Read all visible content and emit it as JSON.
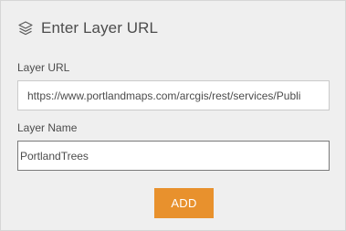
{
  "header": {
    "title": "Enter Layer URL",
    "icon": "layers-icon"
  },
  "form": {
    "url_label": "Layer URL",
    "url_value": "https://www.portlandmaps.com/arcgis/rest/services/Publi",
    "name_label": "Layer Name",
    "name_value": "PortlandTrees",
    "add_label": "ADD"
  },
  "colors": {
    "accent": "#e8912d",
    "panel_bg": "#efefef",
    "text": "#4c4c4c"
  }
}
